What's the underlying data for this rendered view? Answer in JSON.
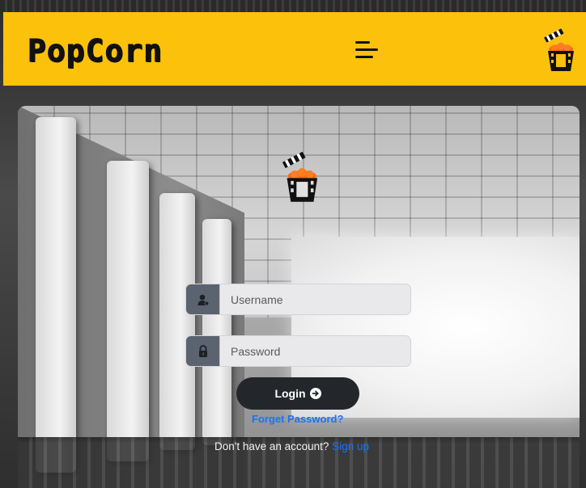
{
  "navbar": {
    "brand": "PopCorn",
    "menu_icon": "hamburger-menu-icon",
    "logo_icon": "popcorn-clapperboard-icon"
  },
  "hero": {
    "logo_icon": "popcorn-clapperboard-icon"
  },
  "login_form": {
    "username": {
      "placeholder": "Username",
      "value": "",
      "icon": "user-icon"
    },
    "password": {
      "placeholder": "Password",
      "value": "",
      "icon": "lock-icon"
    },
    "login_label": "Login",
    "login_icon": "arrow-right-circle-icon",
    "forgot_label": "Forget Password?",
    "signup_prompt": "Don't have an account?",
    "signup_label": "Sign up"
  },
  "colors": {
    "navbar_bg": "#fcc10b",
    "button_bg": "#23272b",
    "link": "#1673ff",
    "addon_bg": "#5b6270"
  }
}
